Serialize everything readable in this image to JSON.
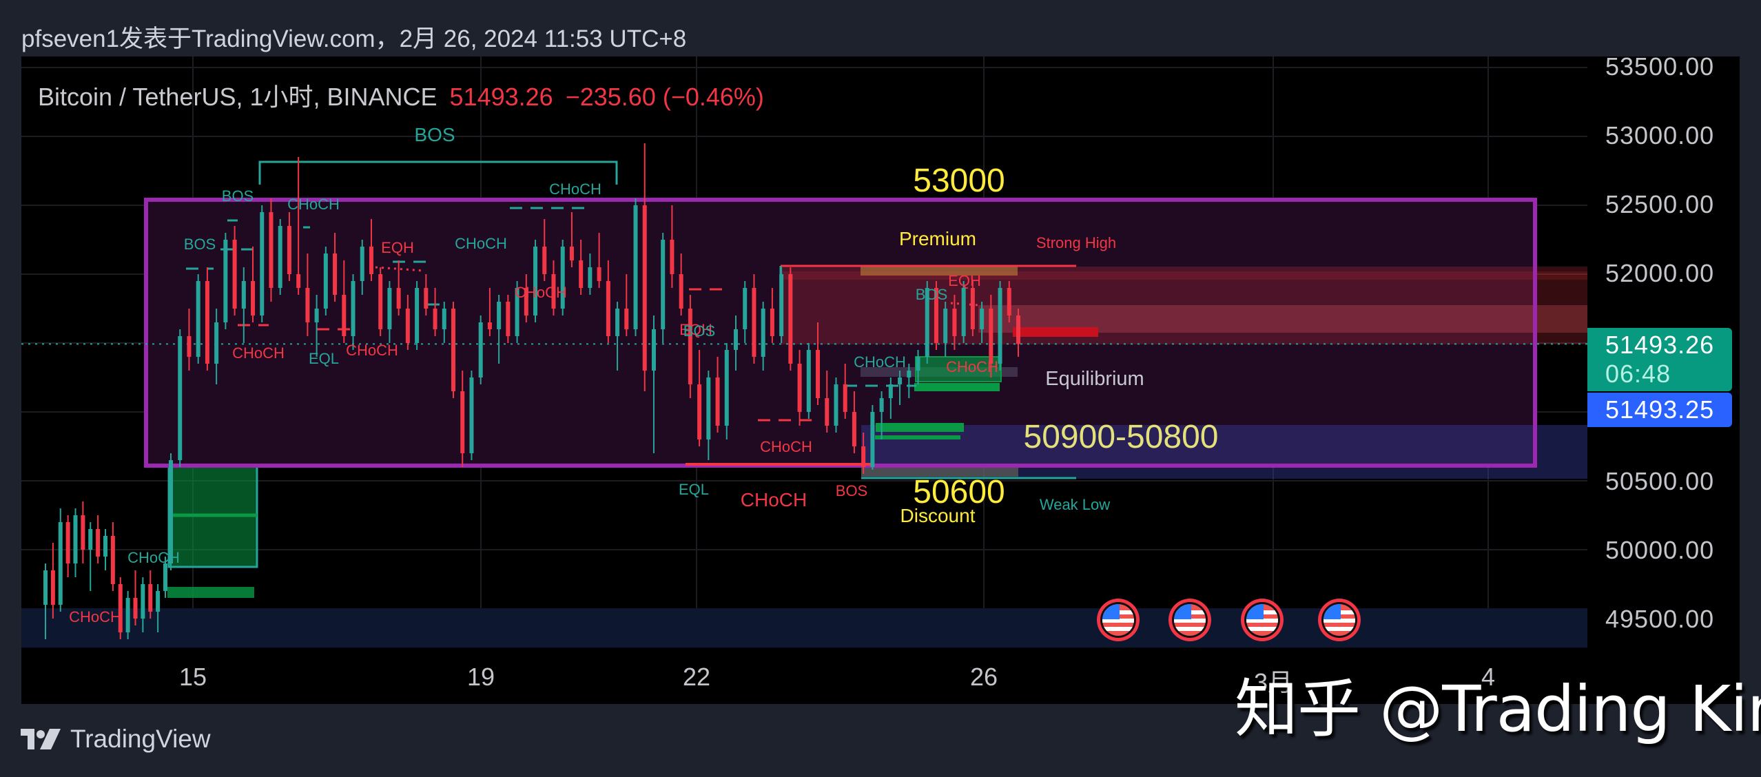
{
  "publish_line": "pfseven1发表于TradingView.com，2月 26, 2024 11:53 UTC+8",
  "legend": {
    "symbol": "Bitcoin / TetherUS, 1小时, BINANCE",
    "price": "51493.26",
    "change": "−235.60 (−0.46%)"
  },
  "price_axis": {
    "labels": [
      "53500.00",
      "53000.00",
      "52500.00",
      "52000.00",
      "50500.00",
      "50000.00",
      "49500.00"
    ],
    "last_price": "51493.26",
    "countdown": "06:48",
    "bid_price": "51493.25"
  },
  "time_axis": {
    "labels": [
      "15",
      "19",
      "22",
      "26",
      "3月",
      "4"
    ]
  },
  "annotations": {
    "level_high": "53000",
    "premium": "Premium",
    "strong_high": "Strong High",
    "equilibrium": "Equilibrium",
    "target_zone": "50900-50800",
    "level_low": "50600",
    "discount": "Discount",
    "weak_low": "Weak Low"
  },
  "events": [
    {
      "icon": "us-flag-icon",
      "label": "US economic event"
    },
    {
      "icon": "us-flag-icon",
      "label": "US economic event"
    },
    {
      "icon": "us-flag-icon",
      "label": "US economic event"
    },
    {
      "icon": "us-flag-icon",
      "label": "US economic event"
    }
  ],
  "footer": {
    "brand": "TradingView"
  },
  "watermark": "知乎 @Trading King",
  "colors": {
    "up": "#26a69a",
    "down": "#f23645",
    "range_box": "#9c27b0",
    "premium_zone": "#f23645",
    "discount_zone": "#2a3a8a",
    "order_block_bull": "#089944",
    "label_yellow": "#ffeb3b",
    "label_yellow_soft": "#e4e07a",
    "last_price_badge": "#089981",
    "bid_badge": "#2962ff"
  },
  "chart_data": {
    "type": "candlestick",
    "title": "Bitcoin / TetherUS, 1H, BINANCE",
    "ylim": [
      49250,
      53600
    ],
    "yticks": [
      49500,
      50000,
      50500,
      51000,
      51500,
      52000,
      52500,
      53000,
      53500
    ],
    "x_tick_labels": [
      "15",
      "19",
      "22",
      "26",
      "3月",
      "4"
    ],
    "last_price": 51493.26,
    "range_box": {
      "top": 52550,
      "bottom": 50620,
      "label_top": "53000",
      "label_bottom": "50600"
    },
    "zones": [
      {
        "name": "premium",
        "top": 52050,
        "bottom": 51650,
        "color": "red"
      },
      {
        "name": "premium-inner",
        "top": 51770,
        "bottom": 51590,
        "color": "red"
      },
      {
        "name": "discount-target",
        "top": 50880,
        "bottom": 50500,
        "color": "blue",
        "label": "50900-50800"
      },
      {
        "name": "lower-band",
        "top": 49560,
        "bottom": 49400,
        "color": "blue"
      },
      {
        "name": "bull-ob-1",
        "top": 50620,
        "bottom": 49880,
        "color": "green"
      },
      {
        "name": "bull-ob-2",
        "top": 49740,
        "bottom": 49690,
        "color": "green"
      }
    ],
    "structure_labels": [
      {
        "text": "BOS",
        "color": "up",
        "x": 0.163,
        "price": 53000
      },
      {
        "text": "BOS",
        "color": "up",
        "x": 0.054,
        "price": 52500
      },
      {
        "text": "CHoCH",
        "color": "up",
        "x": 0.094,
        "price": 52480
      },
      {
        "text": "BOS",
        "color": "up",
        "x": 0.026,
        "price": 52350
      },
      {
        "text": "CHoCH",
        "color": "down",
        "x": 0.072,
        "price": 51480
      },
      {
        "text": "EQL",
        "color": "up",
        "x": 0.111,
        "price": 51450
      },
      {
        "text": "CHoCH",
        "color": "down",
        "x": 0.148,
        "price": 51490
      },
      {
        "text": "EQH",
        "color": "down",
        "x": 0.166,
        "price": 52220
      },
      {
        "text": "CHoCH",
        "color": "up",
        "x": 0.212,
        "price": 52230
      },
      {
        "text": "CHoCH",
        "color": "down",
        "x": 0.252,
        "price": 51930
      },
      {
        "text": "CHoCH",
        "color": "up",
        "x": 0.282,
        "price": 52630
      },
      {
        "text": "EQH",
        "color": "down",
        "x": 0.397,
        "price": 51550
      },
      {
        "text": "BOS",
        "color": "up",
        "x": 0.407,
        "price": 51570
      },
      {
        "text": "EQL",
        "color": "up",
        "x": 0.395,
        "price": 50470
      },
      {
        "text": "CHoCH",
        "color": "down",
        "x": 0.441,
        "price": 50440
      },
      {
        "text": "CHoCH",
        "color": "down",
        "x": 0.452,
        "price": 50740
      },
      {
        "text": "BOS",
        "color": "down",
        "x": 0.48,
        "price": 50470
      },
      {
        "text": "CHoCH",
        "color": "up",
        "x": 0.498,
        "price": 51300
      },
      {
        "text": "BOS",
        "color": "up",
        "x": 0.536,
        "price": 51810
      },
      {
        "text": "EQH",
        "color": "down",
        "x": 0.556,
        "price": 51920
      },
      {
        "text": "CHoCH",
        "color": "down",
        "x": 0.561,
        "price": 51270
      },
      {
        "text": "CHoCH",
        "color": "up",
        "x": 0.069,
        "price": 49950
      },
      {
        "text": "CHoCH",
        "color": "down",
        "x": 0.033,
        "price": 49500
      }
    ],
    "candles": [
      [
        49600,
        49900,
        49350,
        49850
      ],
      [
        49850,
        50050,
        49500,
        49600
      ],
      [
        49600,
        50300,
        49550,
        50200
      ],
      [
        50200,
        50250,
        49800,
        49900
      ],
      [
        49900,
        50300,
        49800,
        50250
      ],
      [
        50250,
        50350,
        49900,
        50000
      ],
      [
        50000,
        50200,
        49700,
        50150
      ],
      [
        50150,
        50250,
        49900,
        49950
      ],
      [
        49950,
        50150,
        49850,
        50100
      ],
      [
        50100,
        50200,
        49700,
        49750
      ],
      [
        49750,
        49800,
        49350,
        49400
      ],
      [
        49400,
        49700,
        49350,
        49650
      ],
      [
        49650,
        49850,
        49450,
        49500
      ],
      [
        49500,
        49800,
        49400,
        49750
      ],
      [
        49750,
        49850,
        49500,
        49550
      ],
      [
        49550,
        49750,
        49400,
        49700
      ],
      [
        49700,
        49950,
        49650,
        49900
      ],
      [
        49900,
        50700,
        49850,
        50650
      ],
      [
        50650,
        51600,
        50600,
        51550
      ],
      [
        51550,
        51750,
        51300,
        51400
      ],
      [
        51400,
        52000,
        51350,
        51950
      ],
      [
        51950,
        52050,
        51300,
        51350
      ],
      [
        51350,
        51750,
        51200,
        51650
      ],
      [
        51650,
        52300,
        51600,
        52250
      ],
      [
        52250,
        52350,
        51700,
        51750
      ],
      [
        51750,
        52050,
        51500,
        51950
      ],
      [
        51950,
        52200,
        51650,
        51700
      ],
      [
        51700,
        52500,
        51650,
        52450
      ],
      [
        52450,
        52550,
        51800,
        51900
      ],
      [
        51900,
        52400,
        51850,
        52350
      ],
      [
        52350,
        52450,
        51950,
        52000
      ],
      [
        52000,
        52850,
        51850,
        51900
      ],
      [
        51900,
        52150,
        51550,
        51650
      ],
      [
        51650,
        51850,
        51400,
        51750
      ],
      [
        51750,
        52200,
        51700,
        52150
      ],
      [
        52150,
        52300,
        51800,
        51850
      ],
      [
        51850,
        52100,
        51500,
        51550
      ],
      [
        51550,
        52000,
        51450,
        51950
      ],
      [
        51950,
        52250,
        51850,
        52200
      ],
      [
        52200,
        52400,
        51950,
        52000
      ],
      [
        52000,
        52050,
        51550,
        51600
      ],
      [
        51600,
        51950,
        51500,
        51900
      ],
      [
        51900,
        52100,
        51700,
        51750
      ],
      [
        51750,
        51850,
        51450,
        51500
      ],
      [
        51500,
        51950,
        51450,
        51900
      ],
      [
        51900,
        52000,
        51700,
        51750
      ],
      [
        51750,
        51900,
        51550,
        51600
      ],
      [
        51600,
        51800,
        51500,
        51750
      ],
      [
        51750,
        51800,
        51100,
        51150
      ],
      [
        51150,
        51300,
        50600,
        50700
      ],
      [
        50700,
        51300,
        50650,
        51250
      ],
      [
        51250,
        51700,
        51200,
        51650
      ],
      [
        51650,
        51900,
        51550,
        51600
      ],
      [
        51600,
        51850,
        51350,
        51800
      ],
      [
        51800,
        51850,
        51500,
        51550
      ],
      [
        51550,
        51950,
        51500,
        51900
      ],
      [
        51900,
        52000,
        51650,
        51700
      ],
      [
        51700,
        52250,
        51650,
        52200
      ],
      [
        52200,
        52400,
        51950,
        52000
      ],
      [
        52000,
        52100,
        51700,
        51750
      ],
      [
        51750,
        52250,
        51700,
        52200
      ],
      [
        52200,
        52450,
        52050,
        52100
      ],
      [
        52100,
        52250,
        51850,
        51900
      ],
      [
        51900,
        52150,
        51850,
        52050
      ],
      [
        52050,
        52300,
        51900,
        51950
      ],
      [
        51950,
        52100,
        51500,
        51550
      ],
      [
        51550,
        51800,
        51300,
        51750
      ],
      [
        51750,
        52000,
        51550,
        51600
      ],
      [
        51600,
        52550,
        51550,
        52500
      ],
      [
        52500,
        52950,
        51150,
        51300
      ],
      [
        51300,
        51700,
        50700,
        51600
      ],
      [
        51600,
        52300,
        51500,
        52250
      ],
      [
        52250,
        52500,
        51900,
        52000
      ],
      [
        52000,
        52150,
        51700,
        51750
      ],
      [
        51750,
        51850,
        51100,
        51200
      ],
      [
        51200,
        51450,
        50750,
        50800
      ],
      [
        50800,
        51300,
        50650,
        51250
      ],
      [
        51250,
        51400,
        50850,
        50900
      ],
      [
        50900,
        51500,
        50800,
        51450
      ],
      [
        51450,
        51700,
        51300,
        51600
      ],
      [
        51600,
        51950,
        51500,
        51900
      ],
      [
        51900,
        52000,
        51350,
        51400
      ],
      [
        51400,
        51800,
        51300,
        51750
      ],
      [
        51750,
        51900,
        51500,
        51550
      ],
      [
        51550,
        52050,
        51500,
        52000
      ],
      [
        52000,
        52050,
        51300,
        51350
      ],
      [
        51350,
        51450,
        50900,
        51000
      ],
      [
        51000,
        51500,
        50950,
        51450
      ],
      [
        51450,
        51650,
        51050,
        51100
      ],
      [
        51100,
        51300,
        50850,
        50900
      ],
      [
        50900,
        51250,
        50850,
        51200
      ],
      [
        51200,
        51350,
        50950,
        51000
      ],
      [
        51000,
        51150,
        50700,
        50750
      ],
      [
        50750,
        50850,
        50550,
        50600
      ],
      [
        50600,
        51050,
        50580,
        51000
      ],
      [
        51000,
        51150,
        50800,
        51100
      ],
      [
        51100,
        51250,
        50950,
        51200
      ],
      [
        51200,
        51300,
        51050,
        51250
      ],
      [
        51250,
        51350,
        51100,
        51300
      ],
      [
        51300,
        51450,
        51200,
        51400
      ],
      [
        51400,
        51950,
        51350,
        51900
      ],
      [
        51900,
        51950,
        51450,
        51500
      ],
      [
        51500,
        51800,
        51400,
        51750
      ],
      [
        51750,
        51850,
        51450,
        51550
      ],
      [
        51550,
        51950,
        51500,
        51900
      ],
      [
        51900,
        51950,
        51550,
        51600
      ],
      [
        51600,
        51800,
        51500,
        51750
      ],
      [
        51750,
        51850,
        51250,
        51350
      ],
      [
        51350,
        51950,
        51300,
        51900
      ],
      [
        51900,
        51950,
        51650,
        51700
      ],
      [
        51700,
        51750,
        51400,
        51493
      ]
    ]
  }
}
